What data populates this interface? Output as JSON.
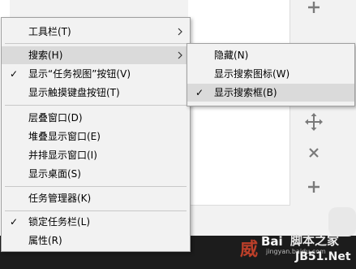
{
  "main_menu": {
    "items": [
      {
        "label": "工具栏(T)",
        "checked": false,
        "submenu": true
      },
      {
        "label": "搜索(H)",
        "checked": false,
        "submenu": true,
        "highlighted": true
      },
      {
        "label": "显示“任务视图”按钮(V)",
        "checked": true,
        "submenu": false
      },
      {
        "label": "显示触摸键盘按钮(T)",
        "checked": false,
        "submenu": false
      },
      {
        "label": "层叠窗口(D)",
        "checked": false,
        "submenu": false
      },
      {
        "label": "堆叠显示窗口(E)",
        "checked": false,
        "submenu": false
      },
      {
        "label": "并排显示窗口(I)",
        "checked": false,
        "submenu": false
      },
      {
        "label": "显示桌面(S)",
        "checked": false,
        "submenu": false
      },
      {
        "label": "任务管理器(K)",
        "checked": false,
        "submenu": false
      },
      {
        "label": "锁定任务栏(L)",
        "checked": true,
        "submenu": false
      },
      {
        "label": "属性(R)",
        "checked": false,
        "submenu": false
      }
    ]
  },
  "search_submenu": {
    "items": [
      {
        "label": "隐藏(N)",
        "checked": false
      },
      {
        "label": "显示搜索图标(W)",
        "checked": false
      },
      {
        "label": "显示搜索框(B)",
        "checked": true,
        "highlighted": true
      }
    ]
  },
  "check_glyph": "✓",
  "side_tools": [
    "plus-icon",
    "move-icon",
    "close-icon",
    "plus-icon"
  ],
  "watermark": {
    "brand": "Bai",
    "brand_red": "威",
    "site_a": "脚本之家",
    "site_b": "JB51.Net",
    "small": "jingyan.baidu.com"
  },
  "colors": {
    "menu_bg": "#f2f2f2",
    "highlight": "#dadada",
    "taskbar": "#1c1c1c"
  }
}
